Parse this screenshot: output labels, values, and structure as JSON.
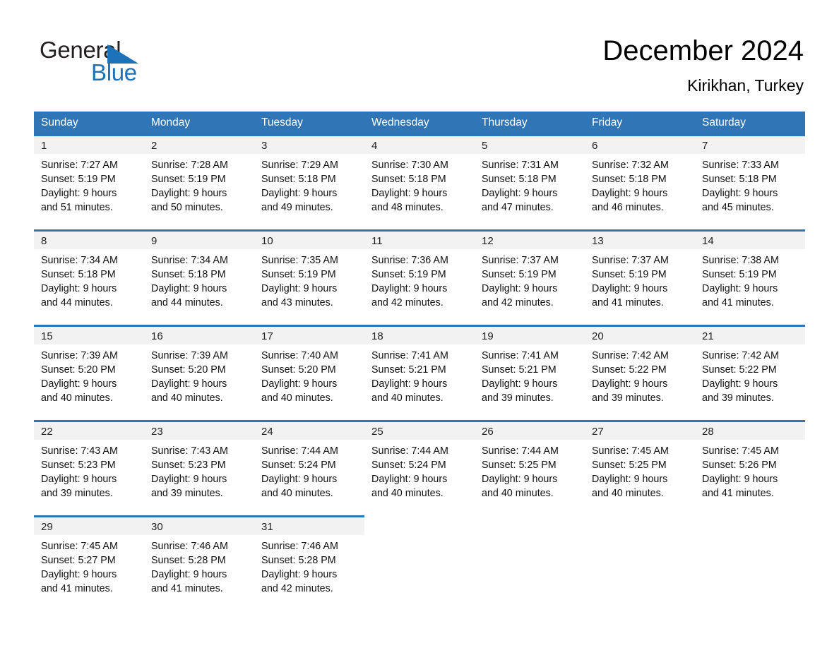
{
  "brand": {
    "name_top": "General",
    "name_bottom": "Blue",
    "triangle_color": "#1b72b8",
    "text_color": "#231f20"
  },
  "header": {
    "title": "December 2024",
    "subtitle": "Kirikhan, Turkey"
  },
  "theme": {
    "header_blue": "#3075b5",
    "row_divider_blue": "#2e75b6",
    "date_band_gray": "#f2f2f2"
  },
  "weekdays": [
    "Sunday",
    "Monday",
    "Tuesday",
    "Wednesday",
    "Thursday",
    "Friday",
    "Saturday"
  ],
  "weeks": [
    [
      {
        "date": "1",
        "sunrise": "Sunrise: 7:27 AM",
        "sunset": "Sunset: 5:19 PM",
        "daylight1": "Daylight: 9 hours",
        "daylight2": "and 51 minutes."
      },
      {
        "date": "2",
        "sunrise": "Sunrise: 7:28 AM",
        "sunset": "Sunset: 5:19 PM",
        "daylight1": "Daylight: 9 hours",
        "daylight2": "and 50 minutes."
      },
      {
        "date": "3",
        "sunrise": "Sunrise: 7:29 AM",
        "sunset": "Sunset: 5:18 PM",
        "daylight1": "Daylight: 9 hours",
        "daylight2": "and 49 minutes."
      },
      {
        "date": "4",
        "sunrise": "Sunrise: 7:30 AM",
        "sunset": "Sunset: 5:18 PM",
        "daylight1": "Daylight: 9 hours",
        "daylight2": "and 48 minutes."
      },
      {
        "date": "5",
        "sunrise": "Sunrise: 7:31 AM",
        "sunset": "Sunset: 5:18 PM",
        "daylight1": "Daylight: 9 hours",
        "daylight2": "and 47 minutes."
      },
      {
        "date": "6",
        "sunrise": "Sunrise: 7:32 AM",
        "sunset": "Sunset: 5:18 PM",
        "daylight1": "Daylight: 9 hours",
        "daylight2": "and 46 minutes."
      },
      {
        "date": "7",
        "sunrise": "Sunrise: 7:33 AM",
        "sunset": "Sunset: 5:18 PM",
        "daylight1": "Daylight: 9 hours",
        "daylight2": "and 45 minutes."
      }
    ],
    [
      {
        "date": "8",
        "sunrise": "Sunrise: 7:34 AM",
        "sunset": "Sunset: 5:18 PM",
        "daylight1": "Daylight: 9 hours",
        "daylight2": "and 44 minutes."
      },
      {
        "date": "9",
        "sunrise": "Sunrise: 7:34 AM",
        "sunset": "Sunset: 5:18 PM",
        "daylight1": "Daylight: 9 hours",
        "daylight2": "and 44 minutes."
      },
      {
        "date": "10",
        "sunrise": "Sunrise: 7:35 AM",
        "sunset": "Sunset: 5:19 PM",
        "daylight1": "Daylight: 9 hours",
        "daylight2": "and 43 minutes."
      },
      {
        "date": "11",
        "sunrise": "Sunrise: 7:36 AM",
        "sunset": "Sunset: 5:19 PM",
        "daylight1": "Daylight: 9 hours",
        "daylight2": "and 42 minutes."
      },
      {
        "date": "12",
        "sunrise": "Sunrise: 7:37 AM",
        "sunset": "Sunset: 5:19 PM",
        "daylight1": "Daylight: 9 hours",
        "daylight2": "and 42 minutes."
      },
      {
        "date": "13",
        "sunrise": "Sunrise: 7:37 AM",
        "sunset": "Sunset: 5:19 PM",
        "daylight1": "Daylight: 9 hours",
        "daylight2": "and 41 minutes."
      },
      {
        "date": "14",
        "sunrise": "Sunrise: 7:38 AM",
        "sunset": "Sunset: 5:19 PM",
        "daylight1": "Daylight: 9 hours",
        "daylight2": "and 41 minutes."
      }
    ],
    [
      {
        "date": "15",
        "sunrise": "Sunrise: 7:39 AM",
        "sunset": "Sunset: 5:20 PM",
        "daylight1": "Daylight: 9 hours",
        "daylight2": "and 40 minutes."
      },
      {
        "date": "16",
        "sunrise": "Sunrise: 7:39 AM",
        "sunset": "Sunset: 5:20 PM",
        "daylight1": "Daylight: 9 hours",
        "daylight2": "and 40 minutes."
      },
      {
        "date": "17",
        "sunrise": "Sunrise: 7:40 AM",
        "sunset": "Sunset: 5:20 PM",
        "daylight1": "Daylight: 9 hours",
        "daylight2": "and 40 minutes."
      },
      {
        "date": "18",
        "sunrise": "Sunrise: 7:41 AM",
        "sunset": "Sunset: 5:21 PM",
        "daylight1": "Daylight: 9 hours",
        "daylight2": "and 40 minutes."
      },
      {
        "date": "19",
        "sunrise": "Sunrise: 7:41 AM",
        "sunset": "Sunset: 5:21 PM",
        "daylight1": "Daylight: 9 hours",
        "daylight2": "and 39 minutes."
      },
      {
        "date": "20",
        "sunrise": "Sunrise: 7:42 AM",
        "sunset": "Sunset: 5:22 PM",
        "daylight1": "Daylight: 9 hours",
        "daylight2": "and 39 minutes."
      },
      {
        "date": "21",
        "sunrise": "Sunrise: 7:42 AM",
        "sunset": "Sunset: 5:22 PM",
        "daylight1": "Daylight: 9 hours",
        "daylight2": "and 39 minutes."
      }
    ],
    [
      {
        "date": "22",
        "sunrise": "Sunrise: 7:43 AM",
        "sunset": "Sunset: 5:23 PM",
        "daylight1": "Daylight: 9 hours",
        "daylight2": "and 39 minutes."
      },
      {
        "date": "23",
        "sunrise": "Sunrise: 7:43 AM",
        "sunset": "Sunset: 5:23 PM",
        "daylight1": "Daylight: 9 hours",
        "daylight2": "and 39 minutes."
      },
      {
        "date": "24",
        "sunrise": "Sunrise: 7:44 AM",
        "sunset": "Sunset: 5:24 PM",
        "daylight1": "Daylight: 9 hours",
        "daylight2": "and 40 minutes."
      },
      {
        "date": "25",
        "sunrise": "Sunrise: 7:44 AM",
        "sunset": "Sunset: 5:24 PM",
        "daylight1": "Daylight: 9 hours",
        "daylight2": "and 40 minutes."
      },
      {
        "date": "26",
        "sunrise": "Sunrise: 7:44 AM",
        "sunset": "Sunset: 5:25 PM",
        "daylight1": "Daylight: 9 hours",
        "daylight2": "and 40 minutes."
      },
      {
        "date": "27",
        "sunrise": "Sunrise: 7:45 AM",
        "sunset": "Sunset: 5:25 PM",
        "daylight1": "Daylight: 9 hours",
        "daylight2": "and 40 minutes."
      },
      {
        "date": "28",
        "sunrise": "Sunrise: 7:45 AM",
        "sunset": "Sunset: 5:26 PM",
        "daylight1": "Daylight: 9 hours",
        "daylight2": "and 41 minutes."
      }
    ],
    [
      {
        "date": "29",
        "sunrise": "Sunrise: 7:45 AM",
        "sunset": "Sunset: 5:27 PM",
        "daylight1": "Daylight: 9 hours",
        "daylight2": "and 41 minutes."
      },
      {
        "date": "30",
        "sunrise": "Sunrise: 7:46 AM",
        "sunset": "Sunset: 5:28 PM",
        "daylight1": "Daylight: 9 hours",
        "daylight2": "and 41 minutes."
      },
      {
        "date": "31",
        "sunrise": "Sunrise: 7:46 AM",
        "sunset": "Sunset: 5:28 PM",
        "daylight1": "Daylight: 9 hours",
        "daylight2": "and 42 minutes."
      },
      {
        "date": "",
        "sunrise": "",
        "sunset": "",
        "daylight1": "",
        "daylight2": ""
      },
      {
        "date": "",
        "sunrise": "",
        "sunset": "",
        "daylight1": "",
        "daylight2": ""
      },
      {
        "date": "",
        "sunrise": "",
        "sunset": "",
        "daylight1": "",
        "daylight2": ""
      },
      {
        "date": "",
        "sunrise": "",
        "sunset": "",
        "daylight1": "",
        "daylight2": ""
      }
    ]
  ]
}
